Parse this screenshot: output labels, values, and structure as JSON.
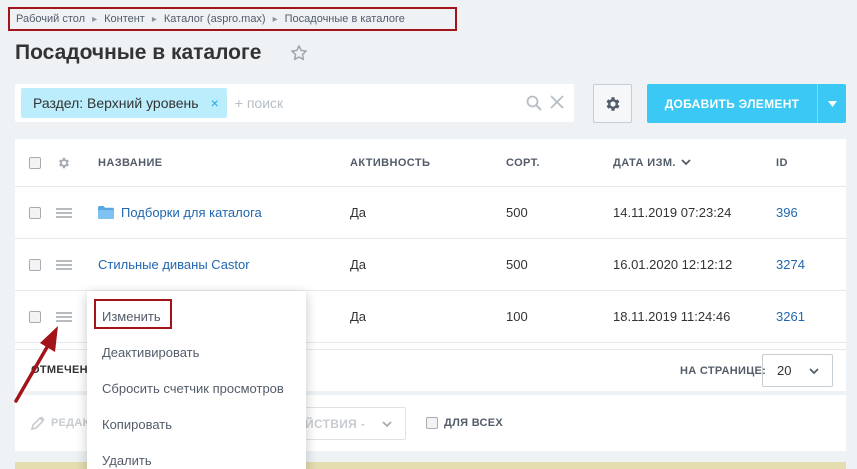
{
  "breadcrumb": {
    "items": [
      {
        "label": "Рабочий стол"
      },
      {
        "label": "Контент"
      },
      {
        "label": "Каталог (aspro.max)"
      },
      {
        "label": "Посадочные в каталоге"
      }
    ]
  },
  "page": {
    "title": "Посадочные в каталоге"
  },
  "filter": {
    "tag_label": "Раздел: Верхний уровень",
    "tag_close": "×",
    "search_placeholder": "+ поиск"
  },
  "toolbar": {
    "add_label": "ДОБАВИТЬ ЭЛЕМЕНТ"
  },
  "table": {
    "headers": {
      "name": "НАЗВАНИЕ",
      "active": "АКТИВНОСТЬ",
      "sort": "СОРТ.",
      "date": "ДАТА ИЗМ.",
      "id": "ID"
    },
    "rows": [
      {
        "name": "Подборки для каталога",
        "active": "Да",
        "sort": "500",
        "date": "14.11.2019 07:23:24",
        "id": "396",
        "icon": "folder-icon"
      },
      {
        "name": "Стильные диваны Castor",
        "active": "Да",
        "sort": "500",
        "date": "16.01.2020 12:12:12",
        "id": "3274"
      },
      {
        "name": "",
        "active": "Да",
        "sort": "100",
        "date": "18.11.2019 11:24:46",
        "id": "3261"
      }
    ]
  },
  "footer": {
    "marked_label": "ОТМЕЧЕН",
    "per_page_label": "НА СТРАНИЦЕ:",
    "per_page_value": "20"
  },
  "actions": {
    "edit_label": "РЕДАК",
    "actions_select_label": "ЕЙСТВИЯ -",
    "for_all_label": "ДЛЯ ВСЕХ"
  },
  "context_menu": {
    "items": [
      {
        "label": "Изменить"
      },
      {
        "label": "Деактивировать"
      },
      {
        "label": "Сбросить счетчик просмотров"
      },
      {
        "label": "Копировать"
      },
      {
        "label": "Удалить"
      }
    ]
  },
  "colors": {
    "accent": "#3bc8f5",
    "link": "#2067b0",
    "highlight": "#a3141a",
    "tag_bg": "#bcedfc"
  }
}
